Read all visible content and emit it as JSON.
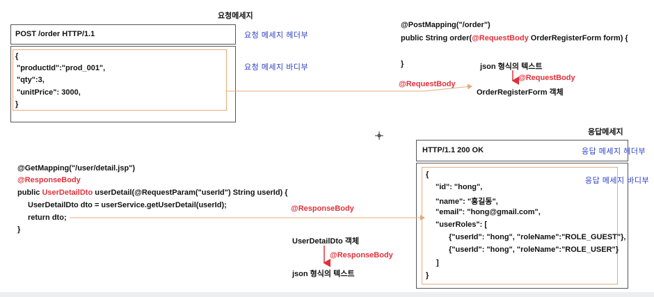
{
  "request": {
    "title": "요청메세지",
    "header_line": "POST /order   HTTP/1.1",
    "header_label": "요청 메세지 헤더부",
    "body_label": "요청 메세지 바디부",
    "body_lines": [
      "{",
      "\"productId\":\"prod_001\",",
      "\"qty\":3,",
      "\"unitPrice\": 3000,",
      "}"
    ]
  },
  "post_code": {
    "line1": "@PostMapping(\"/order\")",
    "line2_prefix": "public String order(",
    "line2_annot": "@RequestBody",
    "line2_suffix": " OrderRegisterForm form) {",
    "line3": "}"
  },
  "post_annot": {
    "json_text": "json 형식의 텍스트",
    "request_body": "@RequestBody",
    "form_object": "OrderRegisterForm 객체",
    "arrow_label": "@RequestBody"
  },
  "response": {
    "title": "응답메세지",
    "header_line": "HTTP/1.1    200   OK",
    "header_label": "응답 메세지 헤더부",
    "body_label": "응답 메세지 바디부",
    "body_lines": [
      "{",
      "\"id\": \"hong\",",
      "\"name\": \"홍길동\",",
      "\"email\": \"hong@gmail.com\",",
      "\"userRoles\": [",
      "{\"userId\": \"hong\", \"roleName\":\"ROLE_GUEST\"},",
      "{\"userId\": \"hong\", \"roleName\":\"ROLE_USER\"}",
      "]",
      "}"
    ]
  },
  "get_code": {
    "line1": "@GetMapping(\"/user/detail.jsp\")",
    "line2": "@ResponseBody",
    "line3_prefix": "public ",
    "line3_type": "UserDetailDto",
    "line3_suffix": " userDetail(@RequestParam(\"userId\") String userId) {",
    "line4": "UserDetailDto dto = userService.getUserDetail(userId);",
    "line5": "return dto;",
    "line6": "}"
  },
  "get_annot": {
    "dto_object": "UserDetailDto 객체",
    "response_body": "@ResponseBody",
    "json_text": "json 형식의 텍스트",
    "arrow_label": "@ResponseBody"
  },
  "colors": {
    "red": "#e0303a",
    "blue": "#2a3fc9",
    "orange_border": "#e8a878"
  }
}
